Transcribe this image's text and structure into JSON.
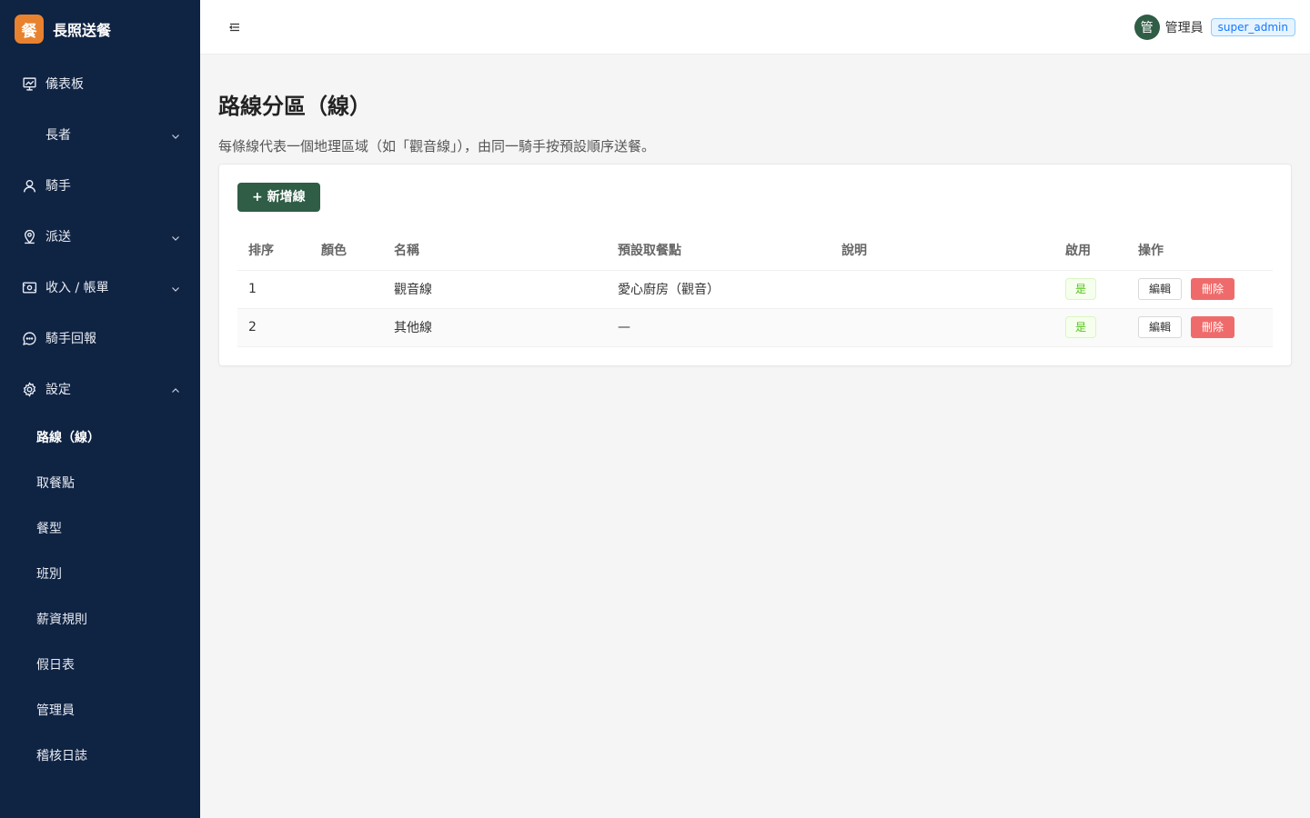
{
  "app": {
    "logo_char": "餐",
    "name": "長照送餐"
  },
  "sidebar": {
    "items": [
      {
        "label": "儀表板",
        "icon": "dashboard-icon"
      },
      {
        "label": "長者",
        "icon": "",
        "chevron": "down"
      },
      {
        "label": "騎手",
        "icon": "user-icon"
      },
      {
        "label": "派送",
        "icon": "location-icon",
        "chevron": "down"
      },
      {
        "label": "收入 / 帳單",
        "icon": "wallet-icon",
        "chevron": "down"
      },
      {
        "label": "騎手回報",
        "icon": "message-icon"
      },
      {
        "label": "設定",
        "icon": "gear-icon",
        "chevron": "up"
      }
    ],
    "settings_sub": [
      "路線（線）",
      "取餐點",
      "餐型",
      "班別",
      "薪資規則",
      "假日表",
      "管理員",
      "稽核日誌"
    ]
  },
  "header": {
    "avatar_char": "管",
    "user_name": "管理員",
    "role": "super_admin"
  },
  "page": {
    "title": "路線分區（線）",
    "description": "每條線代表一個地理區域（如「觀音線」），由同一騎手按預設順序送餐。",
    "add_button": "+ 新增線"
  },
  "table": {
    "headers": [
      "排序",
      "顏色",
      "名稱",
      "預設取餐點",
      "說明",
      "啟用",
      "操作"
    ],
    "rows": [
      {
        "order": "1",
        "color": "",
        "name": "觀音線",
        "pickup": "愛心廚房（觀音）",
        "desc": "",
        "enabled": "是",
        "edit": "編輯",
        "delete": "刪除"
      },
      {
        "order": "2",
        "color": "",
        "name": "其他線",
        "pickup": "—",
        "desc": "",
        "enabled": "是",
        "edit": "編輯",
        "delete": "刪除"
      }
    ]
  },
  "colors": {
    "sidebar_bg": "#0f2343",
    "primary": "#2f5d46",
    "logo": "#e8822f",
    "danger": "#ef6b6b"
  }
}
